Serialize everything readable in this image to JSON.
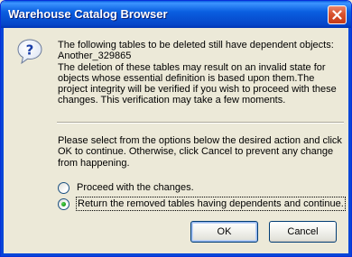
{
  "window": {
    "title": "Warehouse Catalog Browser"
  },
  "icons": {
    "dialog_icon": "question-icon",
    "close": "close-icon"
  },
  "message": {
    "lines": [
      "The following tables to be deleted still have dependent objects:",
      "Another_329865",
      "The deletion of these tables may result on an invalid state for",
      "objects whose essential definition is based upon them.The",
      "project integrity will be verified if you wish to proceed with these",
      "changes. This verification may take a few moments."
    ]
  },
  "instructions": {
    "lines": [
      "Please select from the options below the desired action and click",
      "OK to continue. Otherwise, click Cancel to prevent any change",
      "from happening."
    ]
  },
  "options": [
    {
      "label": "Proceed with the changes.",
      "selected": false
    },
    {
      "label": "Return the removed tables having dependents and continue.",
      "selected": true
    }
  ],
  "buttons": {
    "ok": "OK",
    "cancel": "Cancel"
  },
  "colors": {
    "titlebar": "#0a5fe0",
    "dialog_bg": "#ece9d8",
    "close_button": "#d8532f"
  }
}
